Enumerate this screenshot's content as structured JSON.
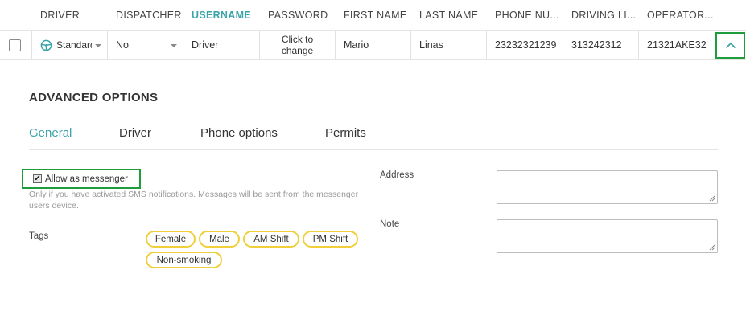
{
  "table": {
    "headers": {
      "driver": "DRIVER",
      "dispatcher": "DISPATCHER",
      "username": "USERNAME",
      "password": "PASSWORD",
      "first_name": "FIRST NAME",
      "last_name": "LAST NAME",
      "phone": "PHONE NU...",
      "driving": "DRIVING LI...",
      "operator": "OPERATOR..."
    },
    "row": {
      "driver_type": "Standard",
      "dispatcher": "No",
      "username": "Driver",
      "password_line1": "Click to",
      "password_line2": "change",
      "first_name": "Mario",
      "last_name": "Linas",
      "phone": "23232321239",
      "driving_license": "313242312",
      "operator": "21321AKE32"
    }
  },
  "advanced": {
    "title": "ADVANCED OPTIONS",
    "tabs": [
      "General",
      "Driver",
      "Phone options",
      "Permits"
    ],
    "active_tab": "General",
    "messenger": {
      "label": "Allow as messenger",
      "checked": true,
      "hint": "Only if you have activated SMS notifications. Messages will be sent from the messenger users device."
    },
    "tags_label": "Tags",
    "tags": [
      "Female",
      "Male",
      "AM Shift",
      "PM Shift",
      "Non-smoking"
    ],
    "address_label": "Address",
    "note_label": "Note"
  },
  "colors": {
    "accent": "#3aa3a8",
    "highlight_border": "#1f9c3c",
    "tag_border": "#f0cf3a"
  }
}
